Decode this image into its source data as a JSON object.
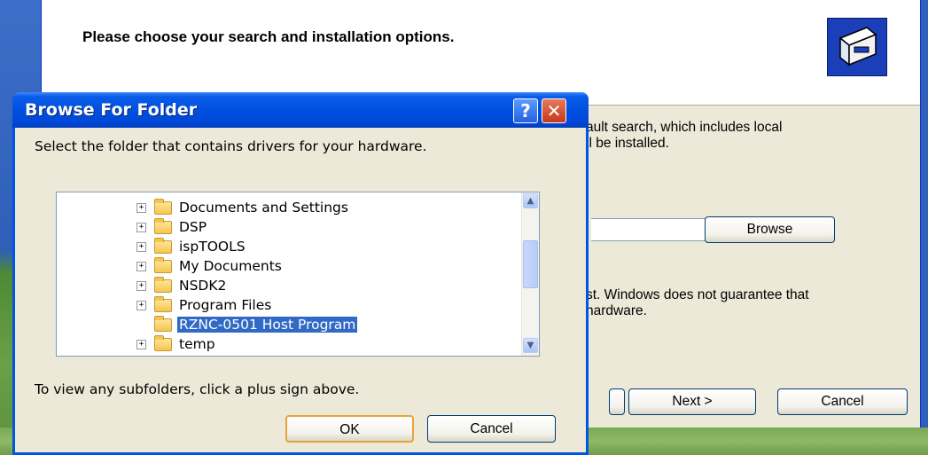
{
  "wizard": {
    "header_title": "Please choose your search and installation options.",
    "body_line1": "ault search, which includes local",
    "body_line2": "ll be installed.",
    "body_line3": "st.  Windows does not guarantee that",
    "body_line4": "hardware.",
    "browse_label": "Browse",
    "next_label": "Next >",
    "cancel_label": "Cancel"
  },
  "dialog": {
    "title": "Browse For Folder",
    "help_glyph": "?",
    "close_glyph": "✕",
    "instruction": "Select the folder that contains drivers for your hardware.",
    "hint": "To view any subfolders, click a plus sign above.",
    "ok_label": "OK",
    "cancel_label": "Cancel",
    "folders": [
      {
        "name": "Documents and Settings",
        "expandable": true,
        "selected": false
      },
      {
        "name": "DSP",
        "expandable": true,
        "selected": false
      },
      {
        "name": "ispTOOLS",
        "expandable": true,
        "selected": false
      },
      {
        "name": "My Documents",
        "expandable": true,
        "selected": false
      },
      {
        "name": "NSDK2",
        "expandable": true,
        "selected": false
      },
      {
        "name": "Program Files",
        "expandable": true,
        "selected": false
      },
      {
        "name": "RZNC-0501 Host Program",
        "expandable": false,
        "selected": true
      },
      {
        "name": "temp",
        "expandable": true,
        "selected": false
      }
    ]
  },
  "colors": {
    "title_bar": "#0050e0",
    "selection": "#316ac5",
    "dialog_bg": "#ece9d8"
  }
}
